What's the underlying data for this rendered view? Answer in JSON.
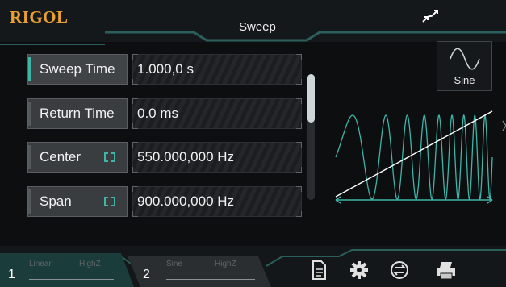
{
  "header": {
    "logo": "RIGOL",
    "title": "Sweep",
    "mode_icon": "sweep-arrows-icon"
  },
  "params": [
    {
      "label": "Sweep Time",
      "value": "1.000,0 s",
      "selected": true,
      "linked": false
    },
    {
      "label": "Return Time",
      "value": "0.0 ms",
      "selected": false,
      "linked": false
    },
    {
      "label": "Center",
      "value": "550.000,000 Hz",
      "selected": false,
      "linked": true
    },
    {
      "label": "Span",
      "value": "900.000,000 Hz",
      "selected": false,
      "linked": true
    }
  ],
  "waveform_button": {
    "label": "Sine",
    "icon": "sine-wave-icon"
  },
  "channels": [
    {
      "number": "1",
      "mode": "Linear",
      "impedance": "HighZ"
    },
    {
      "number": "2",
      "mode": "Sine",
      "impedance": "HighZ"
    }
  ],
  "toolbar_icons": [
    "document-icon",
    "gear-icon",
    "sync-icon",
    "printer-icon"
  ],
  "colors": {
    "accent": "#3fb5a8",
    "logo": "#e8a030",
    "background": "#0c0e10"
  }
}
